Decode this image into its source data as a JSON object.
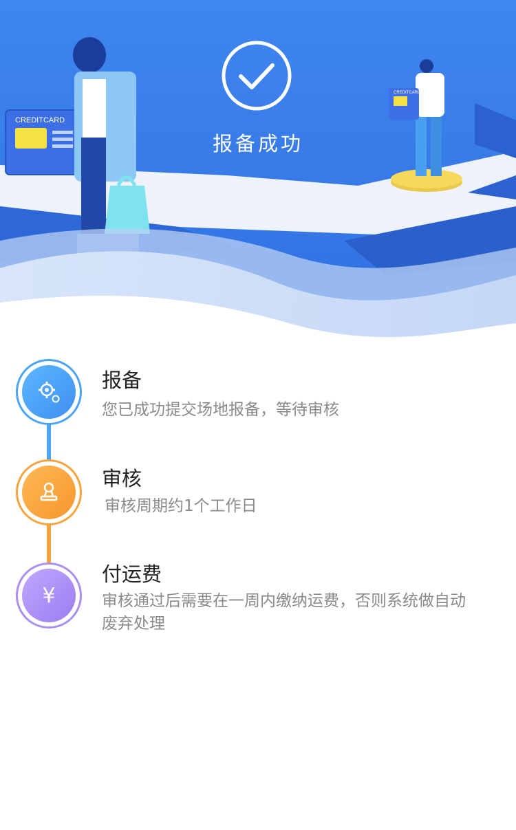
{
  "hero": {
    "title": "报备成功",
    "card_left_label": "CREDITCARD",
    "card_right_label": "CREDITCARD"
  },
  "steps": [
    {
      "title": "报备",
      "desc": "您已成功提交场地报备，等待审核",
      "icon": "gears-icon",
      "color": "#4aa3f5"
    },
    {
      "title": "审核",
      "desc": "审核周期约1个工作日",
      "icon": "stamp-icon",
      "color": "#f7a43c"
    },
    {
      "title": "付运费",
      "desc": "审核通过后需要在一周内缴纳运费，否则系统做自动废弃处理",
      "icon": "yen-icon",
      "yen": "¥",
      "color": "#a98ff0"
    }
  ]
}
